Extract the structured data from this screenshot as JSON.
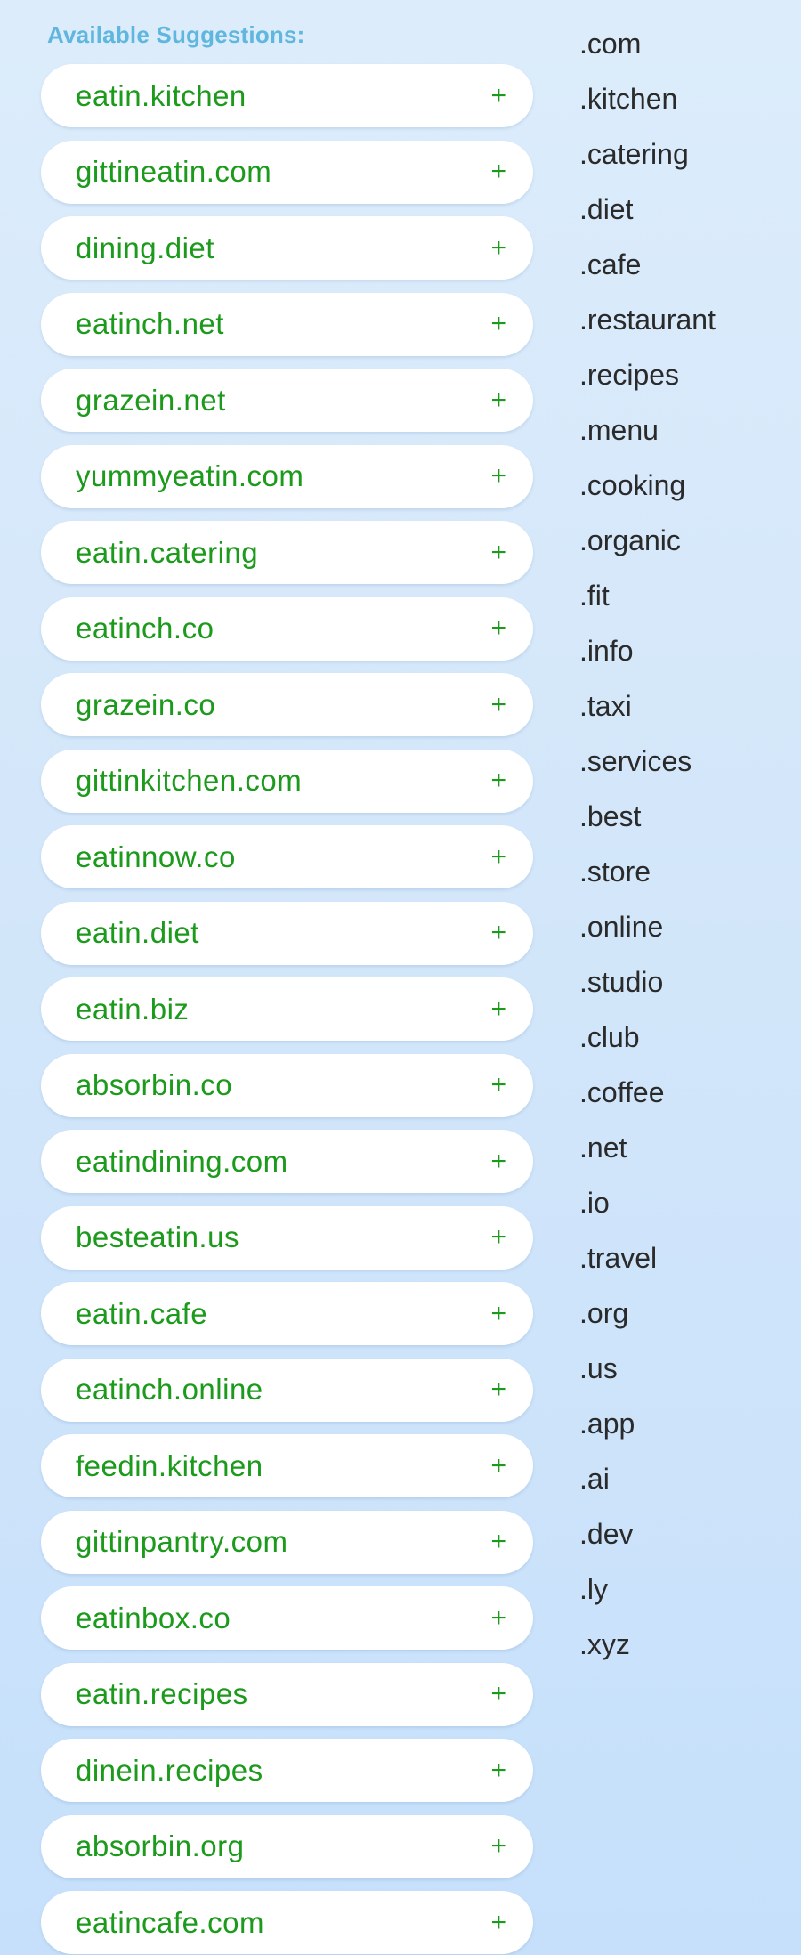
{
  "section_title": "Available Suggestions:",
  "add_symbol": "+",
  "suggestions": [
    "eatin.kitchen",
    "gittineatin.com",
    "dining.diet",
    "eatinch.net",
    "grazein.net",
    "yummyeatin.com",
    "eatin.catering",
    "eatinch.co",
    "grazein.co",
    "gittinkitchen.com",
    "eatinnow.co",
    "eatin.diet",
    "eatin.biz",
    "absorbin.co",
    "eatindining.com",
    "besteatin.us",
    "eatin.cafe",
    "eatinch.online",
    "feedin.kitchen",
    "gittinpantry.com",
    "eatinbox.co",
    "eatin.recipes",
    "dinein.recipes",
    "absorbin.org",
    "eatincafe.com"
  ],
  "tlds": [
    ".com",
    ".kitchen",
    ".catering",
    ".diet",
    ".cafe",
    ".restaurant",
    ".recipes",
    ".menu",
    ".cooking",
    ".organic",
    ".fit",
    ".info",
    ".taxi",
    ".services",
    ".best",
    ".store",
    ".online",
    ".studio",
    ".club",
    ".coffee",
    ".net",
    ".io",
    ".travel",
    ".org",
    ".us",
    ".app",
    ".ai",
    ".dev",
    ".ly",
    ".xyz"
  ],
  "colors": {
    "title": "#5fb6de",
    "suggestion_text": "#1c9a1c",
    "tld_text": "#2a2a2a",
    "background": "#d2e6fa"
  }
}
